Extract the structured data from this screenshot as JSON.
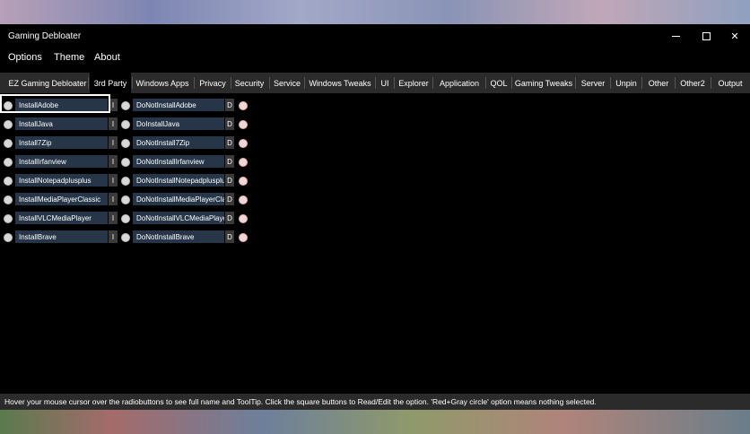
{
  "window": {
    "title": "Gaming Debloater"
  },
  "menu": [
    "Options",
    "Theme",
    "About"
  ],
  "tabs": [
    "EZ Gaming Debloater",
    "3rd Party",
    "Windows Apps",
    "Privacy",
    "Security",
    "Service",
    "Windows Tweaks",
    "UI",
    "Explorer",
    "Application",
    "QOL",
    "Gaming Tweaks",
    "Server",
    "Unpin",
    "Other",
    "Other2",
    "Output"
  ],
  "active_tab": "3rd Party",
  "rows": [
    {
      "install": "InstallAdobe",
      "install_btn": "I",
      "uninstall": "DoNotInstallAdobe",
      "uninstall_btn": "D"
    },
    {
      "install": "InstallJava",
      "install_btn": "I",
      "uninstall": "DoInstallJava",
      "uninstall_btn": "D"
    },
    {
      "install": "Install7Zip",
      "install_btn": "I",
      "uninstall": "DoNotInstall7Zip",
      "uninstall_btn": "D"
    },
    {
      "install": "InstallIrfanview",
      "install_btn": "I",
      "uninstall": "DoNotInstallIrfanview",
      "uninstall_btn": "D"
    },
    {
      "install": "InstallNotepadplusplus",
      "install_btn": "I",
      "uninstall": "DoNotInstallNotepadplusplus",
      "uninstall_btn": "D"
    },
    {
      "install": "InstallMediaPlayerClassic",
      "install_btn": "I",
      "uninstall": "DoNotInstallMediaPlayerClassic",
      "uninstall_btn": "D"
    },
    {
      "install": "InstallVLCMediaPlayer",
      "install_btn": "I",
      "uninstall": "DoNotInstallVLCMediaPlayer",
      "uninstall_btn": "D"
    },
    {
      "install": "InstallBrave",
      "install_btn": "I",
      "uninstall": "DoNotInstallBrave",
      "uninstall_btn": "D"
    }
  ],
  "status": "Hover your mouse cursor over the radiobuttons to see full name and ToolTip. Click the square buttons to Read/Edit the option. 'Red+Gray circle' option means nothing selected.",
  "icons": {
    "minimize": "minimize-icon",
    "maximize": "maximize-icon",
    "close": "close-icon"
  },
  "colors": {
    "option_bg": "#263648",
    "window_bg": "#000000",
    "tabbar_bg": "#2b2b2b"
  }
}
